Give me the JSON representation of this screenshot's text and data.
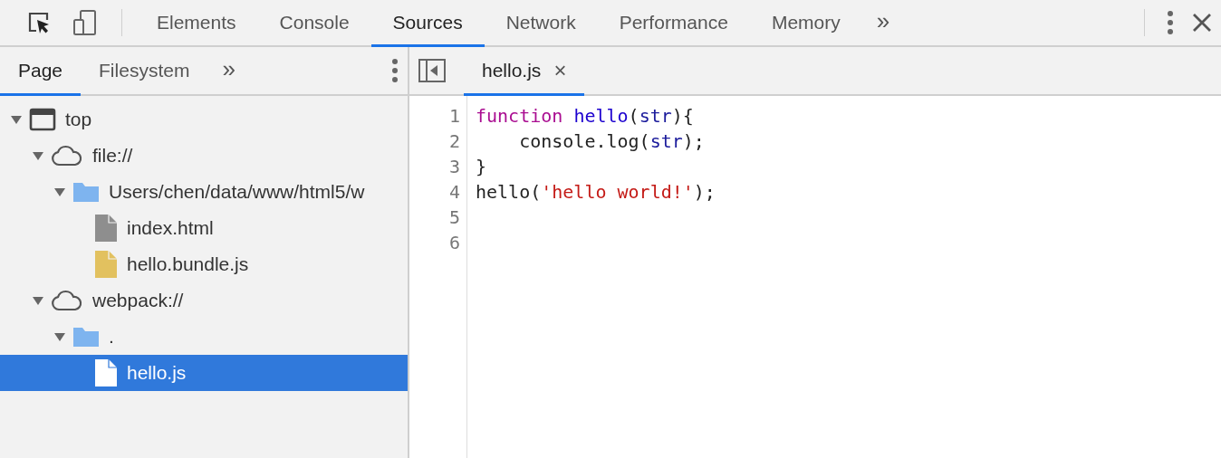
{
  "main_tabs": [
    {
      "label": "Elements",
      "selected": false
    },
    {
      "label": "Console",
      "selected": false
    },
    {
      "label": "Sources",
      "selected": true
    },
    {
      "label": "Network",
      "selected": false
    },
    {
      "label": "Performance",
      "selected": false
    },
    {
      "label": "Memory",
      "selected": false
    }
  ],
  "main_overflow": "»",
  "navigator_tabs": [
    {
      "label": "Page",
      "selected": true
    },
    {
      "label": "Filesystem",
      "selected": false
    }
  ],
  "navigator_overflow": "»",
  "editor_tabs": [
    {
      "label": "hello.js",
      "selected": true,
      "close": "×"
    }
  ],
  "tree": [
    {
      "label": "top",
      "kind": "frame",
      "expanded": true,
      "selected": false,
      "children": [
        {
          "label": "file://",
          "kind": "domain",
          "expanded": true,
          "selected": false,
          "children": [
            {
              "label": "Users/chen/data/www/html5/w",
              "kind": "folder",
              "expanded": true,
              "selected": false,
              "children": [
                {
                  "label": "index.html",
                  "kind": "html-file",
                  "selected": false
                },
                {
                  "label": "hello.bundle.js",
                  "kind": "js-file",
                  "selected": false
                }
              ]
            }
          ]
        },
        {
          "label": "webpack://",
          "kind": "domain",
          "expanded": true,
          "selected": false,
          "children": [
            {
              "label": ".",
              "kind": "folder",
              "expanded": true,
              "selected": false,
              "children": [
                {
                  "label": "hello.js",
                  "kind": "js-file",
                  "selected": true
                }
              ]
            }
          ]
        }
      ]
    }
  ],
  "code_lines": [
    {
      "number": "1",
      "tokens": [
        {
          "kind": "keyword",
          "text": "function "
        },
        {
          "kind": "def",
          "text": "hello"
        },
        {
          "kind": "plain",
          "text": "("
        },
        {
          "kind": "variable",
          "text": "str"
        },
        {
          "kind": "plain",
          "text": "){"
        }
      ]
    },
    {
      "number": "2",
      "tokens": [
        {
          "kind": "plain",
          "text": "    console.log("
        },
        {
          "kind": "variable",
          "text": "str"
        },
        {
          "kind": "plain",
          "text": ");"
        }
      ]
    },
    {
      "number": "3",
      "tokens": [
        {
          "kind": "plain",
          "text": "}"
        }
      ]
    },
    {
      "number": "4",
      "tokens": [
        {
          "kind": "plain",
          "text": "hello("
        },
        {
          "kind": "string",
          "text": "'hello world!'"
        },
        {
          "kind": "plain",
          "text": ");"
        }
      ]
    },
    {
      "number": "5"
    },
    {
      "number": "6"
    }
  ]
}
